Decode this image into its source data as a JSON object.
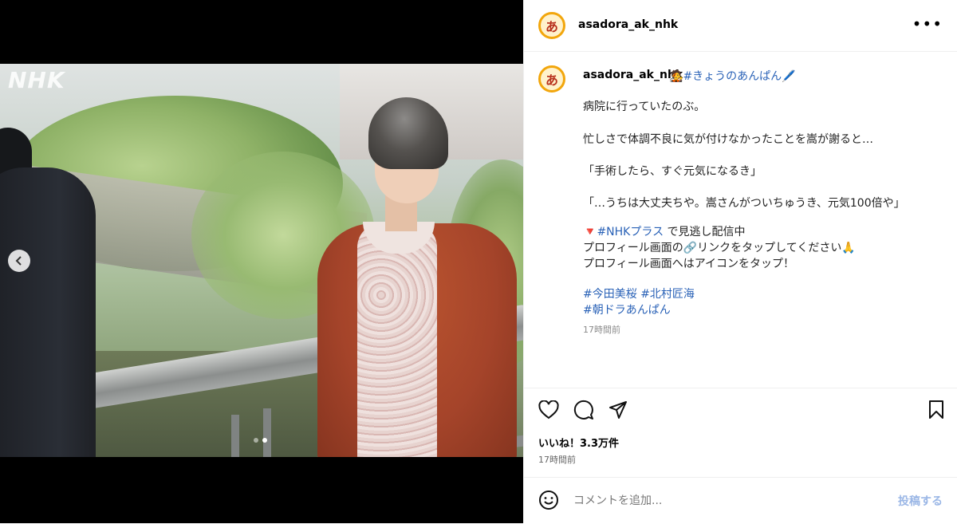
{
  "media": {
    "watermark": "NHK",
    "carousel_dots": 2,
    "active_dot": 1
  },
  "account": {
    "username": "asadora_ak_nhk",
    "avatar_glyph": "あ"
  },
  "header": {
    "more_label": "•••"
  },
  "caption": {
    "username": "asadora_ak_nhk",
    "head_emoji": "🧑‍🎤",
    "head_tag": "#きょうのあんぱん",
    "head_tail_emoji": "🖊️",
    "line1": "病院に行っていたのぶ。",
    "line2": "忙しさで体調不良に気が付けなかったことを嵩が謝ると…",
    "line3": "「手術したら、すぐ元気になるき」",
    "line4": "「…うちは大丈夫ちや。嵩さんがついちゅうき、元気100倍や」",
    "promo_emoji": "🔻",
    "promo_tag": "#NHKプラス",
    "promo_text": " で見逃し配信中",
    "profile_line_a": "プロフィール画面の",
    "link_emoji": "🔗",
    "profile_line_b": "リンクをタップしてください",
    "pray_emoji": "🙏",
    "profile_line2": "プロフィール画面へはアイコンをタップ！",
    "tag1": "#今田美桜",
    "tag2": "#北村匠海",
    "tag3": "#朝ドラあんぱん",
    "time": "17時間前"
  },
  "actions": {
    "likes": "いいね！3.3万件",
    "time": "17時間前"
  },
  "comment": {
    "placeholder": "コメントを追加...",
    "post_label": "投稿する"
  }
}
